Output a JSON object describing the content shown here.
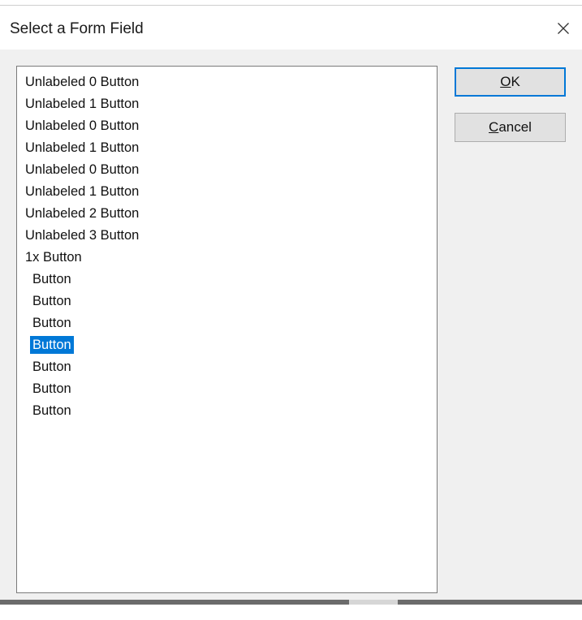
{
  "dialog": {
    "title": "Select a Form Field"
  },
  "list": {
    "items": [
      {
        "label": "Unlabeled 0 Button",
        "indent": false,
        "selected": false
      },
      {
        "label": "Unlabeled 1 Button",
        "indent": false,
        "selected": false
      },
      {
        "label": "Unlabeled 0 Button",
        "indent": false,
        "selected": false
      },
      {
        "label": "Unlabeled 1 Button",
        "indent": false,
        "selected": false
      },
      {
        "label": "Unlabeled 0 Button",
        "indent": false,
        "selected": false
      },
      {
        "label": "Unlabeled 1 Button",
        "indent": false,
        "selected": false
      },
      {
        "label": "Unlabeled 2 Button",
        "indent": false,
        "selected": false
      },
      {
        "label": "Unlabeled 3 Button",
        "indent": false,
        "selected": false
      },
      {
        "label": "1x Button",
        "indent": false,
        "selected": false
      },
      {
        "label": "Button",
        "indent": true,
        "selected": false
      },
      {
        "label": "Button",
        "indent": true,
        "selected": false
      },
      {
        "label": "Button",
        "indent": true,
        "selected": false
      },
      {
        "label": "Button",
        "indent": true,
        "selected": true
      },
      {
        "label": "Button",
        "indent": true,
        "selected": false
      },
      {
        "label": "Button",
        "indent": true,
        "selected": false
      },
      {
        "label": "Button",
        "indent": true,
        "selected": false
      }
    ]
  },
  "buttons": {
    "ok": {
      "mnemonic": "O",
      "rest": "K"
    },
    "cancel": {
      "mnemonic": "C",
      "rest": "ancel"
    }
  },
  "colors": {
    "selection": "#0078d7",
    "dialog_background": "#f0f0f0",
    "default_button_border": "#0078d7"
  }
}
